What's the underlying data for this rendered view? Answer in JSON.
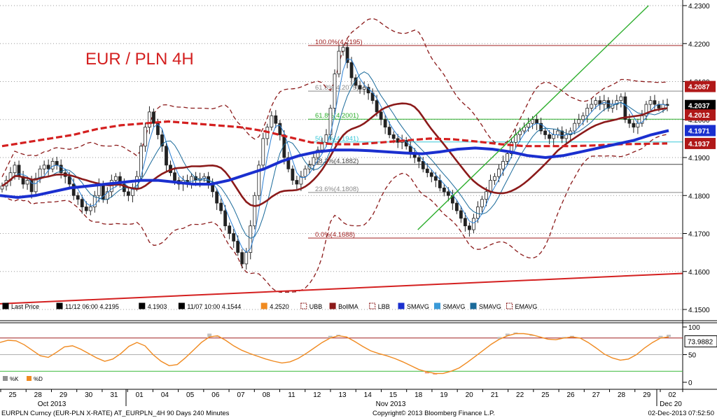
{
  "chart_data": [
    {
      "type": "candlestick",
      "title": "EUR / PLN 4H",
      "ylim": [
        4.15,
        4.23
      ],
      "y_ticks": [
        "4.2300",
        "4.2200",
        "4.2100",
        "4.2000",
        "4.1900",
        "4.1800",
        "4.1700",
        "4.1600",
        "4.1500"
      ],
      "grid": true,
      "x_day_labels": [
        "25",
        "28",
        "29",
        "30",
        "31",
        "01",
        "04",
        "05",
        "06",
        "07",
        "08",
        "11",
        "12",
        "13",
        "14",
        "15",
        "18",
        "19",
        "20",
        "21",
        "22",
        "25",
        "26",
        "27",
        "28",
        "29",
        "02"
      ],
      "x_month_labels": [
        "Oct 2013",
        "Nov 2013",
        "Dec 20"
      ],
      "price_badges": [
        {
          "value": "4.2087",
          "color": "#b01818"
        },
        {
          "value": "4.2037",
          "color": "#000000"
        },
        {
          "value": "4.2012",
          "color": "#b01818"
        },
        {
          "value": "4.1971",
          "color": "#1a2fcf"
        },
        {
          "value": "4.1937",
          "color": "#b01818"
        }
      ],
      "fibonacci": [
        {
          "label": "100.0%(4.2195)",
          "value": 4.2195
        },
        {
          "label": "61.8%(4.2075)",
          "value": 4.2075
        },
        {
          "label": "61.8%(4.2001)",
          "value": 4.2001
        },
        {
          "label": "50.0%(4.1941)",
          "value": 4.1941
        },
        {
          "label": "38.2%(4.1882)",
          "value": 4.1882
        },
        {
          "label": "23.6%(4.1808)",
          "value": 4.1808
        },
        {
          "label": "0.0%(4.1688)",
          "value": 4.1688
        }
      ],
      "trendlines": [
        {
          "name": "support-red",
          "from": [
            0,
            4.1515
          ],
          "to": [
            1,
            4.1595
          ],
          "color": "#d42020"
        },
        {
          "name": "uptrend-green",
          "from": [
            0.612,
            4.171
          ],
          "to": [
            0.95,
            4.23
          ],
          "color": "#2cae2c"
        }
      ],
      "legend": [
        {
          "label": "Last Price",
          "icon": "candle-icon"
        },
        {
          "label": "11/12 06:00 4.2195",
          "icon": "high-marker-icon"
        },
        {
          "label": "4.1903",
          "icon": "cross-marker-icon"
        },
        {
          "label": "11/07 10:00 4.1544",
          "icon": "low-marker-icon"
        },
        {
          "label": "4.2520",
          "icon": "orange-square-icon"
        },
        {
          "label": "UBB",
          "icon": "dashed-red-icon"
        },
        {
          "label": "BollMA",
          "icon": "maroon-square-icon"
        },
        {
          "label": "LBB",
          "icon": "dashed-red-icon"
        },
        {
          "label": "SMAVG",
          "icon": "blue-square-icon"
        },
        {
          "label": "SMAVG",
          "icon": "lightblue-square-icon"
        },
        {
          "label": "SMAVG",
          "icon": "steelblue-square-icon"
        },
        {
          "label": "EMAVG",
          "icon": "dashed-red-icon"
        }
      ],
      "close_series": [
        4.1825,
        4.184,
        4.186,
        4.188,
        4.185,
        4.183,
        4.184,
        4.181,
        4.1845,
        4.187,
        4.188,
        4.187,
        4.189,
        4.188,
        4.186,
        4.185,
        4.183,
        4.18,
        4.179,
        4.177,
        4.176,
        4.177,
        4.18,
        4.183,
        4.179,
        4.181,
        4.184,
        4.185,
        4.183,
        4.181,
        4.18,
        4.182,
        4.185,
        4.193,
        4.198,
        4.202,
        4.199,
        4.196,
        4.193,
        4.188,
        4.186,
        4.184,
        4.183,
        4.184,
        4.183,
        4.185,
        4.184,
        4.1845,
        4.185,
        4.183,
        4.181,
        4.178,
        4.176,
        4.172,
        4.17,
        4.168,
        4.165,
        4.162,
        4.165,
        4.172,
        4.18,
        4.188,
        4.195,
        4.198,
        4.201,
        4.199,
        4.196,
        4.19,
        4.187,
        4.184,
        4.183,
        4.185,
        4.187,
        4.188,
        4.19,
        4.192,
        4.194,
        4.196,
        4.203,
        4.212,
        4.218,
        4.219,
        4.215,
        4.211,
        4.209,
        4.208,
        4.2085,
        4.207,
        4.205,
        4.202,
        4.2,
        4.198,
        4.196,
        4.195,
        4.194,
        4.1945,
        4.193,
        4.191,
        4.19,
        4.189,
        4.187,
        4.186,
        4.185,
        4.184,
        4.182,
        4.181,
        4.18,
        4.178,
        4.176,
        4.174,
        4.172,
        4.171,
        4.174,
        4.177,
        4.179,
        4.181,
        4.184,
        4.185,
        4.187,
        4.189,
        4.191,
        4.194,
        4.196,
        4.197,
        4.198,
        4.199,
        4.2,
        4.199,
        4.197,
        4.196,
        4.195,
        4.196,
        4.197,
        4.195,
        4.196,
        4.197,
        4.199,
        4.2,
        4.201,
        4.203,
        4.204,
        4.205,
        4.204,
        4.205,
        4.203,
        4.204,
        4.205,
        4.206,
        4.2,
        4.199,
        4.198,
        4.199,
        4.201,
        4.204,
        4.205,
        4.204,
        4.203,
        4.204,
        4.2037
      ],
      "ema_series": [
        4.193,
        4.194,
        4.195,
        4.196,
        4.1975,
        4.1985,
        4.199,
        4.1995,
        4.199,
        4.1985,
        4.198,
        4.197,
        4.1955,
        4.194,
        4.1935,
        4.1935,
        4.194,
        4.1945,
        4.195,
        4.1948,
        4.1942,
        4.1935,
        4.193,
        4.193,
        4.193,
        4.1932,
        4.1935,
        4.1936,
        4.1937
      ],
      "sma_series": [
        4.18,
        4.1795,
        4.18,
        4.181,
        4.182,
        4.1825,
        4.183,
        4.1835,
        4.184,
        4.184,
        4.1835,
        4.183,
        4.183,
        4.184,
        4.1855,
        4.187,
        4.189,
        4.1905,
        4.1915,
        4.192,
        4.192,
        4.1918,
        4.1915,
        4.1912,
        4.191,
        4.1915,
        4.1922,
        4.1925,
        4.1922,
        4.1915,
        4.1905,
        4.19,
        4.1905,
        4.1915,
        4.1925,
        4.1935,
        4.1945,
        4.196,
        4.1971
      ]
    },
    {
      "type": "line",
      "ylim": [
        0,
        100
      ],
      "y_ticks": [
        "100",
        "50",
        "0"
      ],
      "reference_lines": [
        80,
        50,
        20
      ],
      "last_value": "73.9882",
      "legend": [
        {
          "label": "%K",
          "icon": "grey-square-icon"
        },
        {
          "label": "%D",
          "icon": "orange-square-icon"
        }
      ],
      "k_series": [
        70,
        80,
        74,
        62,
        50,
        40,
        45,
        60,
        70,
        66,
        58,
        48,
        40,
        34,
        44,
        58,
        72,
        78,
        60,
        42,
        32,
        26,
        34,
        50,
        66,
        80,
        88,
        82,
        72,
        62,
        54,
        48,
        44,
        40,
        36,
        34,
        38,
        46,
        56,
        66,
        76,
        84,
        86,
        80,
        70,
        60,
        54,
        50,
        46,
        40,
        34,
        26,
        20,
        16,
        14,
        16,
        22,
        30,
        40,
        52,
        64,
        74,
        82,
        88,
        90,
        88,
        84,
        80,
        76,
        76,
        82,
        84,
        78,
        68,
        56,
        46,
        40,
        38,
        44,
        56,
        68,
        78,
        84,
        86
      ],
      "d_series": [
        72,
        76,
        75,
        68,
        58,
        48,
        45,
        54,
        64,
        66,
        60,
        52,
        44,
        38,
        42,
        52,
        65,
        72,
        66,
        50,
        38,
        30,
        32,
        44,
        58,
        72,
        82,
        84,
        76,
        66,
        58,
        52,
        47,
        42,
        38,
        35,
        37,
        43,
        52,
        62,
        72,
        80,
        84,
        82,
        74,
        65,
        57,
        52,
        48,
        43,
        37,
        30,
        23,
        19,
        16,
        16,
        20,
        26,
        36,
        47,
        58,
        69,
        78,
        84,
        88,
        88,
        86,
        82,
        78,
        77,
        80,
        82,
        80,
        72,
        62,
        51,
        44,
        40,
        42,
        50,
        62,
        72,
        80,
        82
      ]
    },
    {
      "type": "footer",
      "ticker_text": "EURPLN Curncy (EUR-PLN X-RATE) AT_EURPLN_4H 90 Days 240 Minutes",
      "copyright": "Copyright© 2013 Bloomberg Finance L.P.",
      "timestamp": "02-Dec-2013 07:52:50"
    }
  ]
}
